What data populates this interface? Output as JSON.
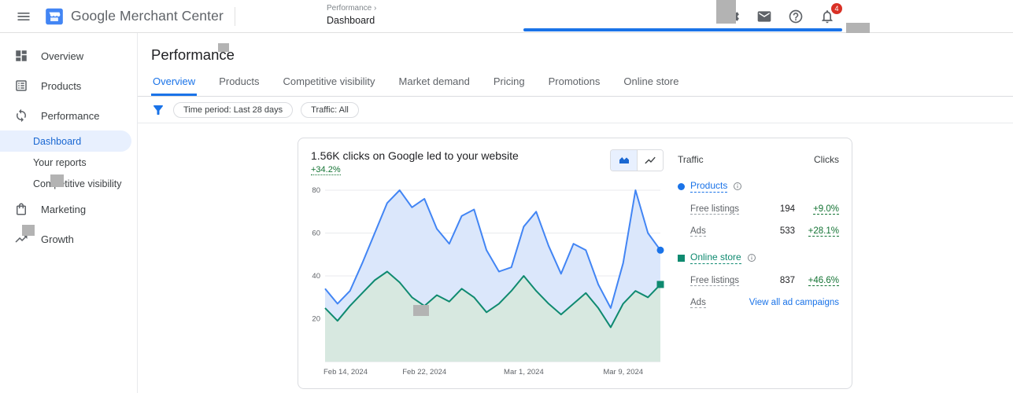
{
  "header": {
    "brand": {
      "google": "Google",
      "product": "Merchant Center"
    },
    "breadcrumb": {
      "parent": "Performance",
      "chevron": "›",
      "current": "Dashboard"
    },
    "notification_badge": "4"
  },
  "sidebar": {
    "items": [
      {
        "label": "Overview"
      },
      {
        "label": "Products"
      },
      {
        "label": "Performance"
      },
      {
        "label": "Dashboard"
      },
      {
        "label": "Your reports"
      },
      {
        "label": "Competitive visibility"
      },
      {
        "label": "Marketing"
      },
      {
        "label": "Growth"
      }
    ]
  },
  "page": {
    "title": "Performance"
  },
  "tabs": [
    {
      "label": "Overview"
    },
    {
      "label": "Products"
    },
    {
      "label": "Competitive visibility"
    },
    {
      "label": "Market demand"
    },
    {
      "label": "Pricing"
    },
    {
      "label": "Promotions"
    },
    {
      "label": "Online store"
    }
  ],
  "filters": {
    "chips": [
      {
        "label": "Time period: Last 28 days"
      },
      {
        "label": "Traffic: All"
      }
    ]
  },
  "card": {
    "title": "1.56K clicks on Google led to your website",
    "delta": "+34.2%"
  },
  "traffic": {
    "header": {
      "traffic": "Traffic",
      "clicks": "Clicks"
    },
    "groups": [
      {
        "name": "Products",
        "color": "#1a73e8",
        "rows": [
          {
            "label": "Free listings",
            "value": "194",
            "delta": "+9.0%"
          },
          {
            "label": "Ads",
            "value": "533",
            "delta": "+28.1%"
          }
        ]
      },
      {
        "name": "Online store",
        "color": "#0f8a70",
        "rows": [
          {
            "label": "Free listings",
            "value": "837",
            "delta": "+46.6%"
          },
          {
            "label": "Ads",
            "link": "View all ad campaigns"
          }
        ]
      }
    ]
  },
  "chart_data": {
    "type": "area",
    "title": "1.56K clicks on Google led to your website",
    "subtitle": "+34.2%",
    "ylim": [
      0,
      80
    ],
    "yticks": [
      20,
      40,
      60,
      80
    ],
    "xticks": [
      {
        "label": "Feb 14, 2024",
        "index": 0
      },
      {
        "label": "Feb 22, 2024",
        "index": 8
      },
      {
        "label": "Mar 1, 2024",
        "index": 16
      },
      {
        "label": "Mar 9, 2024",
        "index": 24
      }
    ],
    "series": [
      {
        "name": "Products",
        "color": "#4285f4",
        "fill": "#dbe7fb",
        "marker": "circle",
        "marker_color": "#1a73e8",
        "values": [
          34,
          27,
          33,
          46,
          60,
          74,
          80,
          72,
          76,
          62,
          55,
          68,
          71,
          52,
          42,
          44,
          63,
          70,
          54,
          41,
          55,
          52,
          36,
          25,
          46,
          80,
          60,
          52
        ]
      },
      {
        "name": "Online store",
        "color": "#0f8a70",
        "fill": "#d7e8e0",
        "marker": "square",
        "marker_color": "#0f8a70",
        "values": [
          25,
          19,
          26,
          32,
          38,
          42,
          37,
          30,
          26,
          31,
          28,
          34,
          30,
          23,
          27,
          33,
          40,
          33,
          27,
          22,
          27,
          32,
          25,
          16,
          27,
          33,
          30,
          36
        ]
      }
    ]
  }
}
